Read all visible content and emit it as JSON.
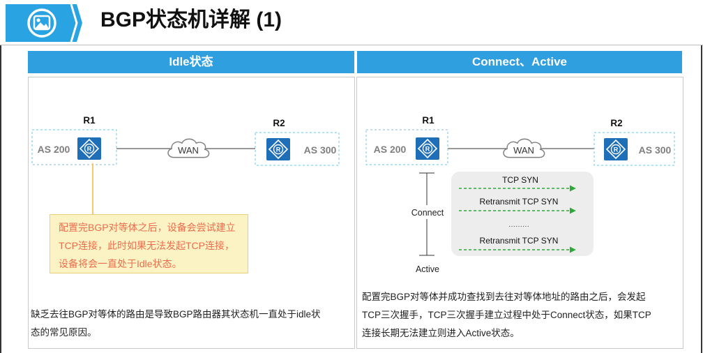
{
  "page": {
    "title": "BGP状态机详解 (1)"
  },
  "icon": {
    "name": "image-icon"
  },
  "left_panel": {
    "header": "Idle状态",
    "r1_label": "R1",
    "r2_label": "R2",
    "as1": "AS 200",
    "as2": "AS 300",
    "wan": "WAN",
    "note_lines": [
      "配置完BGP对等体之后，设备会尝试建立",
      "TCP连接，此时如果无法发起TCP连接，",
      "设备将会一直处于Idle状态。"
    ],
    "desc_lines": [
      "缺乏去往BGP对等体的路由是导致BGP路由器其状态机一直处于idle状",
      "态的常见原因。"
    ]
  },
  "right_panel": {
    "header": "Connect、Active",
    "r1_label": "R1",
    "r2_label": "R2",
    "as1": "AS 200",
    "as2": "AS 300",
    "wan": "WAN",
    "connect_label": "Connect",
    "active_label": "Active",
    "messages": [
      "TCP SYN",
      "Retransmit TCP SYN",
      "·········",
      "Retransmit TCP SYN"
    ],
    "desc_lines": [
      "配置完BGP对等体并成功查找到去往对等体地址的路由之后，会发起",
      "TCP三次握手，TCP三次握手建立过程中处于Connect状态，如果TCP",
      "连接长期无法建立则进入Active状态。"
    ]
  },
  "colors": {
    "header_blue": "#2f9fe0",
    "router_blue": "#1f6fb8",
    "note_bg": "#fcf3c5",
    "note_text": "#ec6d4c",
    "arrow_green": "#2fa83a",
    "dashed_box": "#6ec6ea",
    "callout_line": "#f5c96a"
  }
}
